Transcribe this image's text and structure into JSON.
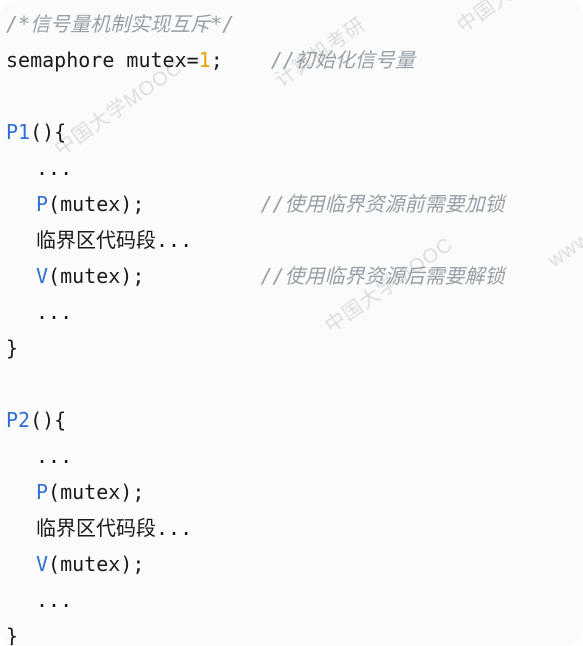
{
  "code": {
    "header_comment": "/*信号量机制实现互斥*/",
    "line_semaphore_prefix": "semaphore mutex=",
    "line_semaphore_value": "1",
    "line_semaphore_suffix": ";",
    "line_semaphore_comment": "//初始化信号量",
    "p1_name": "P1",
    "p2_name": "P2",
    "func_suffix": "(){",
    "ellipsis": "...",
    "p_call_name": "P",
    "v_call_name": "V",
    "call_arg": "(mutex);",
    "critical_section": "临界区代码段...",
    "close_brace": "}",
    "p_comment": "//使用临界资源前需要加锁",
    "v_comment": "//使用临界资源后需要解锁"
  },
  "watermarks": [
    "中国大学MOOC",
    "计算机考研",
    "www.csaoyan.com"
  ]
}
